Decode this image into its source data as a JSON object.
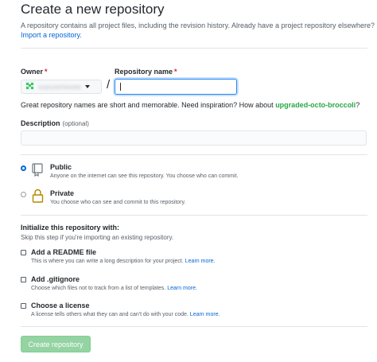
{
  "header": {
    "title": "Create a new repository",
    "subtitle": "A repository contains all project files, including the revision history. Already have a project repository elsewhere?",
    "import_link": "Import a repository."
  },
  "owner": {
    "label": "Owner",
    "required_mark": "*",
    "value": "supryashewate"
  },
  "repo_name": {
    "label": "Repository name",
    "required_mark": "*",
    "value": ""
  },
  "separator": "/",
  "hint": {
    "text": "Great repository names are short and memorable. Need inspiration? How about",
    "suggestion": "upgraded-octo-broccoli",
    "end": "?"
  },
  "description": {
    "label": "Description",
    "optional": "(optional)",
    "value": ""
  },
  "visibility": {
    "options": [
      {
        "title": "Public",
        "desc": "Anyone on the internet can see this repository. You choose who can commit.",
        "checked": true,
        "icon": "repo-icon"
      },
      {
        "title": "Private",
        "desc": "You choose who can see and commit to this repository.",
        "checked": false,
        "icon": "lock-icon"
      }
    ]
  },
  "init": {
    "heading": "Initialize this repository with:",
    "subheading": "Skip this step if you're importing an existing repository.",
    "options": [
      {
        "title": "Add a README file",
        "desc": "This is where you can write a long description for your project.",
        "link": "Learn more."
      },
      {
        "title": "Add .gitignore",
        "desc": "Choose which files not to track from a list of templates.",
        "link": "Learn more."
      },
      {
        "title": "Choose a license",
        "desc": "A license tells others what they can and can't do with your code.",
        "link": "Learn more."
      }
    ]
  },
  "create_button": "Create repository",
  "colors": {
    "accent_blue": "#0366d6",
    "suggestion_green": "#28a745",
    "button_green_disabled": "#94d3a2",
    "required_red": "#cb2431"
  }
}
